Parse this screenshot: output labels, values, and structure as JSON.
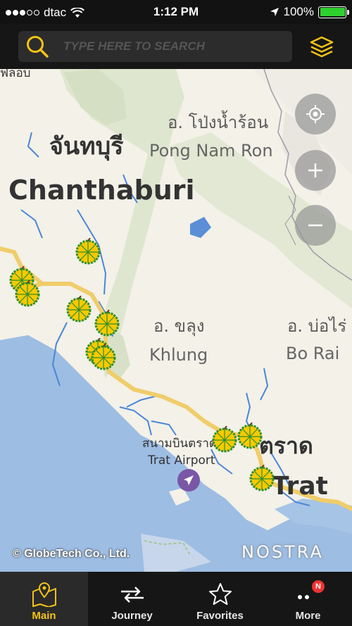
{
  "status_bar": {
    "carrier": "dtac",
    "time": "1:12 PM",
    "battery": "100%",
    "signal_bars_filled": 3,
    "signal_bars_total": 5
  },
  "search": {
    "placeholder": "TYPE HERE TO SEARCH",
    "value": ""
  },
  "icons": {
    "search": "search-icon",
    "layers": "layers-icon",
    "locate": "crosshair-icon",
    "zoom_in": "plus-icon",
    "zoom_out": "minus-icon",
    "airport": "airplane-icon",
    "pin": "durian-icon"
  },
  "colors": {
    "accent": "#f3c316",
    "bar_bg": "#161616",
    "pin_fill": "#f7c900",
    "pin_ring": "#2d8f2d",
    "airport": "#7a57a6",
    "badge": "#e33333"
  },
  "map": {
    "labels": {
      "chanthaburi_th": "จันทบุรี",
      "chanthaburi_en": "Chanthaburi",
      "pong_th": "อ. โป่งน้ำร้อน",
      "pong_en": "Pong Nam Ron",
      "khlung_th": "อ. ขลุง",
      "khlung_en": "Khlung",
      "borai_th": "อ. บ่อไร่",
      "borai_en": "Bo Rai",
      "airport_th": "สนามบินตราด",
      "airport_en": "Trat Airport",
      "trat_th": "ตราด",
      "trat_en": "Trat",
      "cutoff_top": "ฟลอบ"
    },
    "copyright": "© GlobeTech Co., Ltd.",
    "brand": "NOSTRA"
  },
  "tabs": [
    {
      "label": "Main",
      "icon": "map-pin-icon",
      "active": true
    },
    {
      "label": "Journey",
      "icon": "journey-arrows-icon",
      "active": false
    },
    {
      "label": "Favorites",
      "icon": "star-icon",
      "active": false
    },
    {
      "label": "More",
      "icon": "more-dots-icon",
      "active": false,
      "badge": "N"
    }
  ]
}
